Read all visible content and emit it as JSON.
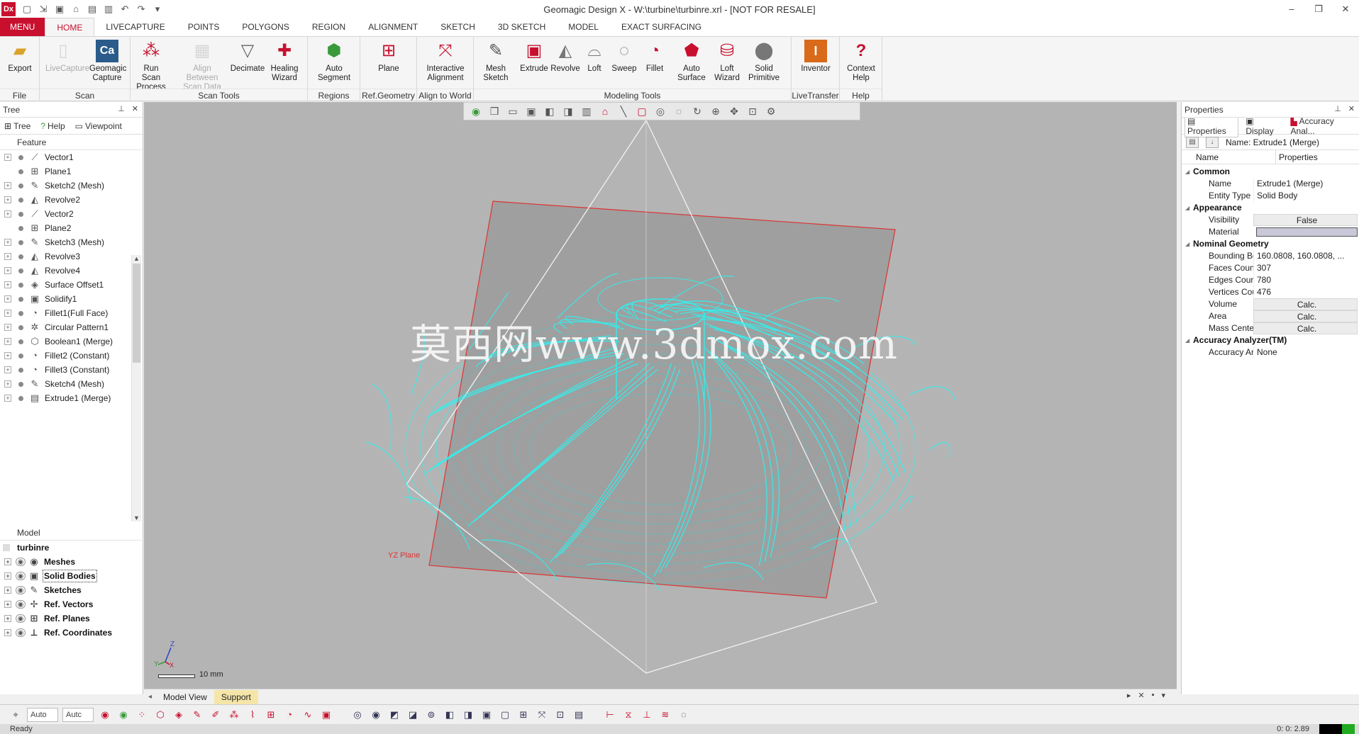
{
  "window": {
    "title": "Geomagic Design X - W:\\turbine\\turbinre.xrl - [NOT FOR RESALE]",
    "app_icon": "Dx"
  },
  "tabs": [
    "MENU",
    "HOME",
    "LIVECAPTURE",
    "POINTS",
    "POLYGONS",
    "REGION",
    "ALIGNMENT",
    "SKETCH",
    "3D SKETCH",
    "MODEL",
    "EXACT SURFACING"
  ],
  "ribbon": {
    "groups": {
      "file": "File",
      "scan": "Scan",
      "scan_tools": "Scan Tools",
      "regions": "Regions",
      "ref_geometry": "Ref.Geometry",
      "align": "Align to World",
      "modeling": "Modeling Tools",
      "livetransfer": "LiveTransfer",
      "help": "Help"
    },
    "buttons": {
      "export": "Export",
      "livecapture": "LiveCapture",
      "geomagic_capture": "Geomagic Capture",
      "run_scan": "Run Scan Process",
      "align_between": "Align Between Scan Data",
      "decimate": "Decimate",
      "healing": "Healing Wizard",
      "auto_segment": "Auto Segment",
      "plane": "Plane",
      "interactive_alignment": "Interactive Alignment",
      "mesh_sketch": "Mesh Sketch",
      "extrude": "Extrude",
      "revolve": "Revolve",
      "loft": "Loft",
      "sweep": "Sweep",
      "fillet": "Fillet",
      "auto_surface": "Auto Surface",
      "loft_wizard": "Loft Wizard",
      "solid_primitive": "Solid Primitive",
      "inventor": "Inventor",
      "context_help": "Context Help"
    }
  },
  "tree_panel": {
    "title": "Tree",
    "subtabs": [
      "Tree",
      "Help",
      "Viewpoint"
    ],
    "feature_header": "Feature",
    "features": [
      "Vector1",
      "Plane1",
      "Sketch2 (Mesh)",
      "Revolve2",
      "Vector2",
      "Plane2",
      "Sketch3 (Mesh)",
      "Revolve3",
      "Revolve4",
      "Surface Offset1",
      "Solidify1",
      "Fillet1(Full Face)",
      "Circular Pattern1",
      "Boolean1 (Merge)",
      "Fillet2 (Constant)",
      "Fillet3 (Constant)",
      "Sketch4 (Mesh)",
      "Extrude1 (Merge)"
    ],
    "model_header": "Model",
    "model_root": "turbinre",
    "model_items": [
      "Meshes",
      "Solid Bodies",
      "Sketches",
      "Ref. Vectors",
      "Ref. Planes",
      "Ref. Coordinates"
    ]
  },
  "viewport": {
    "watermark": "莫西网www.3dmox.com",
    "plane_label": "YZ Plane",
    "scale_label": "10 mm",
    "axis_x": "X",
    "axis_y": "Y",
    "axis_z": "Z",
    "bg_color": "#b4b4b4",
    "mesh_color": "#2ef2f0"
  },
  "view_tabs": [
    "Model View",
    "Support"
  ],
  "properties": {
    "title": "Properties",
    "tabs": [
      "Properties",
      "Display",
      "Accuracy Anal..."
    ],
    "name_label": "Name: Extrude1 (Merge)",
    "col_name": "Name",
    "col_props": "Properties",
    "categories": {
      "common": "Common",
      "appearance": "Appearance",
      "nominal": "Nominal Geometry",
      "accuracy": "Accuracy Analyzer(TM)"
    },
    "rows": {
      "name_k": "Name",
      "name_v": "Extrude1 (Merge)",
      "type_k": "Entity Type",
      "type_v": "Solid Body",
      "vis_k": "Visibility",
      "vis_v": "False",
      "mat_k": "Material",
      "bbox_k": "Bounding Box",
      "bbox_v": "160.0808, 160.0808, ...",
      "faces_k": "Faces Count",
      "faces_v": "307",
      "edges_k": "Edges Count",
      "edges_v": "780",
      "verts_k": "Vertices Count",
      "verts_v": "476",
      "vol_k": "Volume",
      "vol_v": "Calc.",
      "area_k": "Area",
      "area_v": "Calc.",
      "mass_k": "Mass Center",
      "mass_v": "Calc.",
      "acc_k": "Accuracy Analyz...",
      "acc_v": "None"
    }
  },
  "bottom": {
    "sel1": "Auto",
    "sel2": "Autc"
  },
  "status": {
    "text": "Ready",
    "time": "0: 0: 2.89"
  },
  "colors": {
    "accent": "#c8102e",
    "support_tab": "#f5e6a8"
  }
}
